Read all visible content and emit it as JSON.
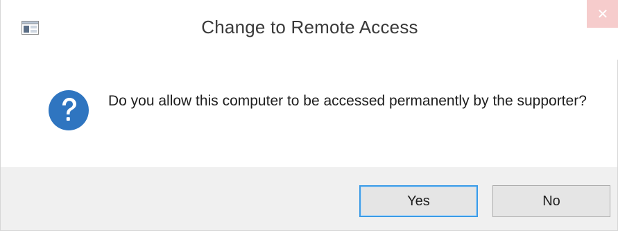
{
  "window": {
    "title": "Change to Remote Access",
    "close_glyph": "✕"
  },
  "message": {
    "text": "Do you allow this computer to be accessed permanently by the supporter?",
    "icon": "question-icon",
    "icon_color": "#2f75c0"
  },
  "buttons": {
    "yes_label": "Yes",
    "no_label": "No"
  },
  "colors": {
    "accent": "#3c9be6",
    "close_bg": "#f6cccc",
    "footer_bg": "#f0f0f0"
  }
}
